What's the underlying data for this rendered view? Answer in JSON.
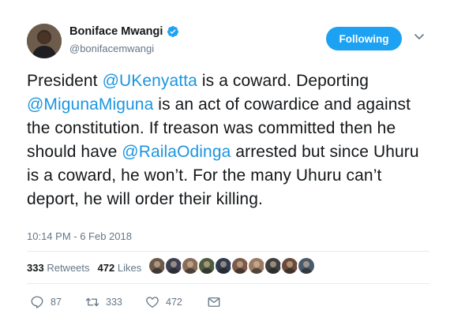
{
  "author": {
    "display_name": "Boniface Mwangi",
    "handle": "@bonifacemwangi",
    "verified": true
  },
  "follow_button": {
    "label": "Following"
  },
  "tweet": {
    "segments": [
      {
        "text": "President ",
        "type": "text"
      },
      {
        "text": "@UKenyatta",
        "type": "mention"
      },
      {
        "text": " is a coward. Deporting ",
        "type": "text"
      },
      {
        "text": "@MigunaMiguna",
        "type": "mention"
      },
      {
        "text": " is an act of cowardice and against the constitution. If treason was committed then he should have ",
        "type": "text"
      },
      {
        "text": "@RailaOdinga",
        "type": "mention"
      },
      {
        "text": " arrested but since Uhuru is a coward, he won’t. For the many Uhuru can’t deport, he will order their killing.",
        "type": "text"
      }
    ],
    "timestamp": "10:14 PM - 6 Feb 2018"
  },
  "stats": {
    "retweets_count": "333",
    "retweets_label": "Retweets",
    "likes_count": "472",
    "likes_label": "Likes"
  },
  "likers": {
    "count_shown": 10,
    "colors": [
      "#6b5a4a",
      "#3d3f52",
      "#8a6d58",
      "#4f5b3f",
      "#2f3b4f",
      "#7d5b4a",
      "#9a7a63",
      "#3f3f3f",
      "#6a4b3a",
      "#4a5a6a"
    ]
  },
  "actions": {
    "reply_count": "87",
    "retweet_count": "333",
    "like_count": "472"
  },
  "colors": {
    "accent": "#1da1f2",
    "mention": "#1b95e0",
    "muted": "#657786",
    "text": "#14171a"
  }
}
